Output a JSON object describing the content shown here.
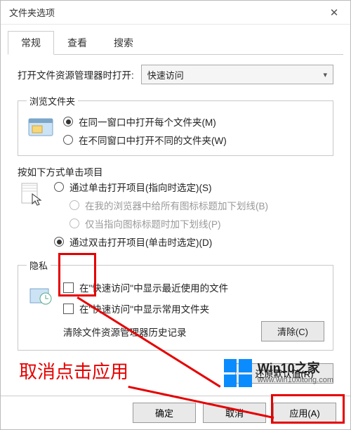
{
  "window": {
    "title": "文件夹选项"
  },
  "tabs": [
    {
      "label": "常规",
      "active": true
    },
    {
      "label": "查看",
      "active": false
    },
    {
      "label": "搜索",
      "active": false
    }
  ],
  "openWith": {
    "label": "打开文件资源管理器时打开:",
    "value": "快速访问"
  },
  "browse": {
    "legend": "浏览文件夹",
    "icon": "folder-window-icon",
    "options": [
      {
        "text": "在同一窗口中打开每个文件夹(M)",
        "selected": true
      },
      {
        "text": "在不同窗口中打开不同的文件夹(W)",
        "selected": false
      }
    ]
  },
  "click": {
    "heading": "按如下方式单击项目",
    "icon": "cursor-click-icon",
    "options": [
      {
        "text": "通过单击打开项目(指向时选定)(S)",
        "selected": false,
        "sub": [
          {
            "text": "在我的浏览器中给所有图标标题加下划线(B)"
          },
          {
            "text": "仅当指向图标标题时加下划线(P)"
          }
        ]
      },
      {
        "text": "通过双击打开项目(单击时选定)(D)",
        "selected": true
      }
    ]
  },
  "privacy": {
    "legend": "隐私",
    "icon": "privacy-clock-icon",
    "checks": [
      {
        "text": "在\"快速访问\"中显示最近使用的文件",
        "checked": false
      },
      {
        "text": "在\"快速访问\"中显示常用文件夹",
        "checked": false
      }
    ],
    "clearLabel": "清除文件资源管理器历史记录",
    "clearBtn": "清除(C)"
  },
  "buttons": {
    "restore": "还原默认值(R)",
    "ok": "确定",
    "cancel": "取消",
    "apply": "应用(A)"
  },
  "annotation": {
    "text": "取消点击应用"
  },
  "brand": {
    "name": "Win10之家",
    "url": "www.win10xitong.com"
  }
}
